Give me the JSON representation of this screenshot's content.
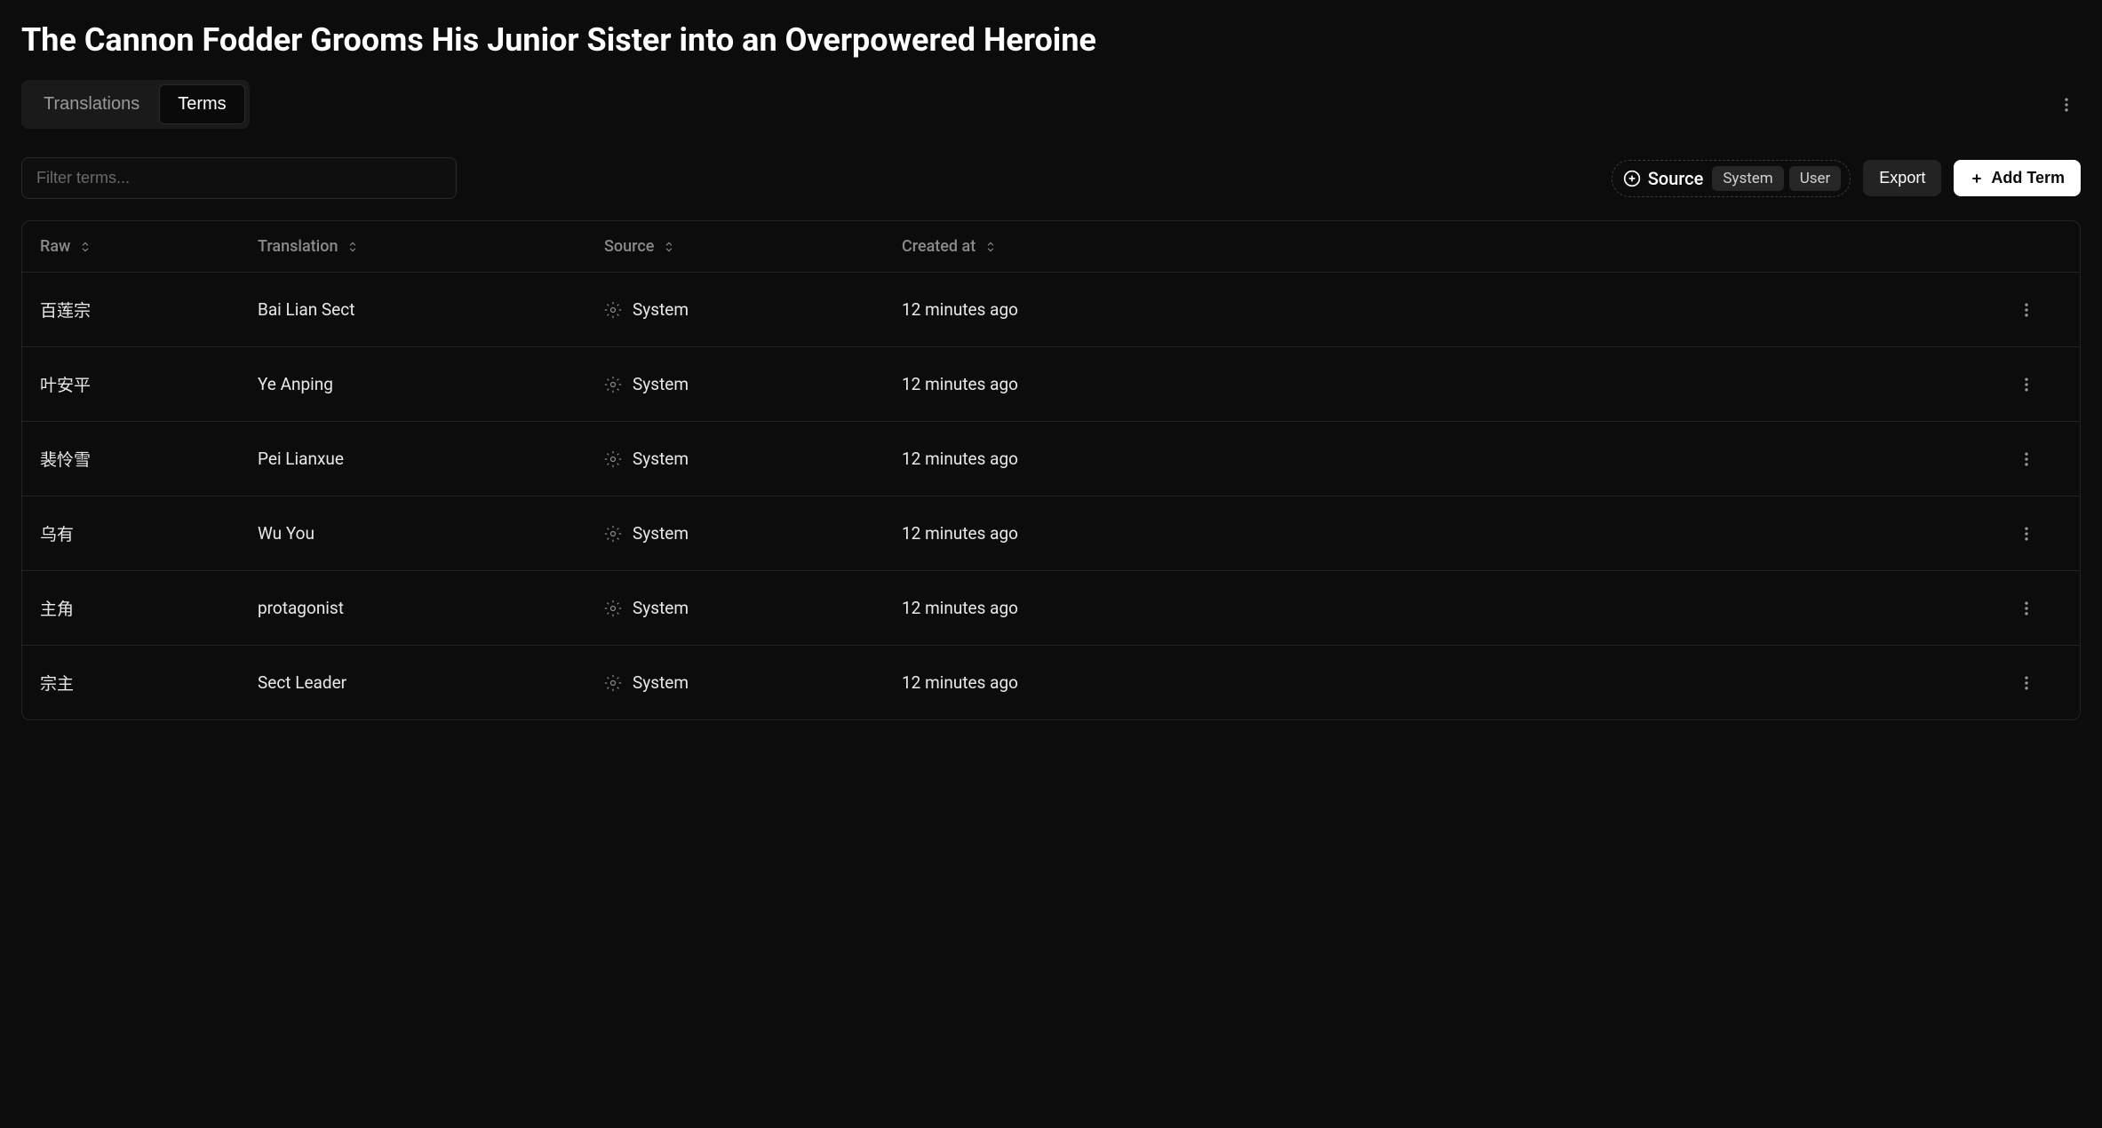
{
  "page_title": "The Cannon Fodder Grooms His Junior Sister into an Overpowered Heroine",
  "tabs": {
    "translations": "Translations",
    "terms": "Terms"
  },
  "filter": {
    "placeholder": "Filter terms..."
  },
  "source_filter": {
    "label": "Source",
    "chips": [
      "System",
      "User"
    ]
  },
  "buttons": {
    "export": "Export",
    "add_term": "Add Term"
  },
  "columns": {
    "raw": "Raw",
    "translation": "Translation",
    "source": "Source",
    "created_at": "Created at"
  },
  "rows": [
    {
      "raw": "百莲宗",
      "translation": "Bai Lian Sect",
      "source": "System",
      "created_at": "12 minutes ago"
    },
    {
      "raw": "叶安平",
      "translation": "Ye Anping",
      "source": "System",
      "created_at": "12 minutes ago"
    },
    {
      "raw": "裴怜雪",
      "translation": "Pei Lianxue",
      "source": "System",
      "created_at": "12 minutes ago"
    },
    {
      "raw": "乌有",
      "translation": "Wu You",
      "source": "System",
      "created_at": "12 minutes ago"
    },
    {
      "raw": "主角",
      "translation": "protagonist",
      "source": "System",
      "created_at": "12 minutes ago"
    },
    {
      "raw": "宗主",
      "translation": "Sect Leader",
      "source": "System",
      "created_at": "12 minutes ago"
    }
  ]
}
